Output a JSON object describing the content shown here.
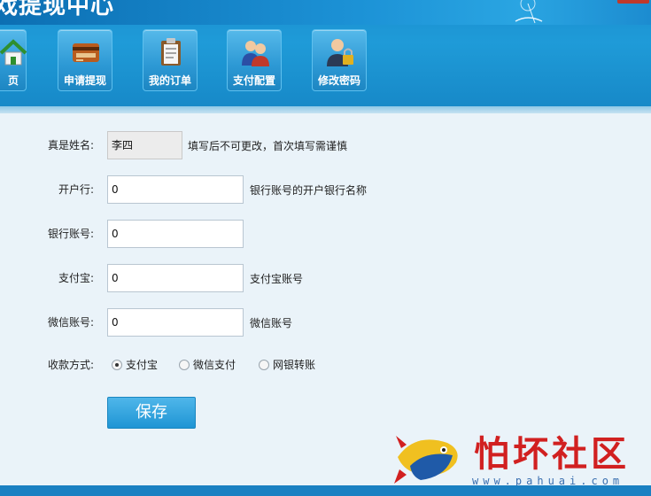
{
  "header": {
    "site_title": "戏提现中心"
  },
  "nav": {
    "items": [
      {
        "label": "页",
        "icon": "home-icon"
      },
      {
        "label": "申请提现",
        "icon": "card-icon"
      },
      {
        "label": "我的订单",
        "icon": "clipboard-icon"
      },
      {
        "label": "支付配置",
        "icon": "users-icon"
      },
      {
        "label": "修改密码",
        "icon": "user-lock-icon"
      }
    ]
  },
  "form": {
    "real_name": {
      "label": "真是姓名:",
      "value": "李四",
      "hint": "填写后不可更改，首次填写需谨慎"
    },
    "bank_name": {
      "label": "开户行:",
      "value": "0",
      "hint": "银行账号的开户银行名称"
    },
    "bank_account": {
      "label": "银行账号:",
      "value": "0"
    },
    "alipay": {
      "label": "支付宝:",
      "value": "0",
      "hint": "支付宝账号"
    },
    "wechat": {
      "label": "微信账号:",
      "value": "0",
      "hint": "微信账号"
    },
    "payment_method": {
      "label": "收款方式:",
      "options": [
        "支付宝",
        "微信支付",
        "网银转账"
      ],
      "selected": "支付宝"
    },
    "save_label": "保存"
  },
  "watermark": {
    "text": "怕坏社区",
    "url": "www.pahuai.com"
  },
  "colors": {
    "header_blue": "#1f9bd8",
    "button_blue": "#2a9fdc",
    "watermark_red": "#d12020"
  }
}
